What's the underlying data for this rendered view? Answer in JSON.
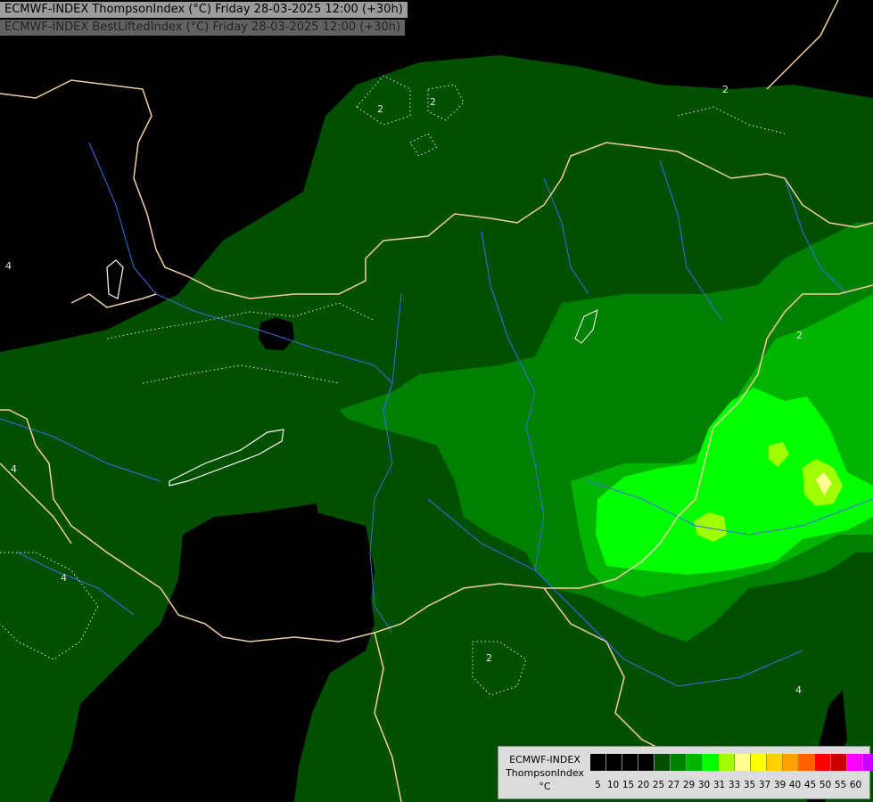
{
  "header": {
    "title_line1": "ECMWF-INDEX ThompsonIndex (°C) Friday 28-03-2025 12:00 (+30h)",
    "title_line2": "ECMWF-INDEX BestLiftedIndex (°C) Friday 28-03-2025 12:00 (+30h)"
  },
  "map": {
    "contour_labels": [
      "2",
      "2",
      "2",
      "2",
      "2",
      "4",
      "4",
      "4",
      "4"
    ],
    "colors": {
      "background": "#000000",
      "dark_green": "#005000",
      "mid_green": "#008000",
      "bright_green": "#00b400",
      "lime": "#00ff00",
      "yellow_green": "#a0ff00",
      "light_yellow": "#ffff90",
      "border": "#f0d0a0",
      "river": "#3c6cd8",
      "contour": "#e6e6e6"
    }
  },
  "legend": {
    "label_line1": "ECMWF-INDEX",
    "label_line2": "ThompsonIndex",
    "label_line3": "°C",
    "colors": [
      "#000000",
      "#000000",
      "#000000",
      "#000000",
      "#005000",
      "#008000",
      "#00b400",
      "#00ff00",
      "#a0ff00",
      "#ffff90",
      "#ffff00",
      "#ffd000",
      "#ffa000",
      "#ff6000",
      "#ff0000",
      "#c80000",
      "#ff00ff",
      "#c800ff",
      "#8000ff",
      "#6400ff",
      "#0000ff"
    ],
    "ticks": [
      "5",
      "10",
      "15",
      "20",
      "25",
      "27",
      "29",
      "30",
      "31",
      "33",
      "35",
      "37",
      "39",
      "40",
      "45",
      "50",
      "55",
      "60"
    ]
  }
}
